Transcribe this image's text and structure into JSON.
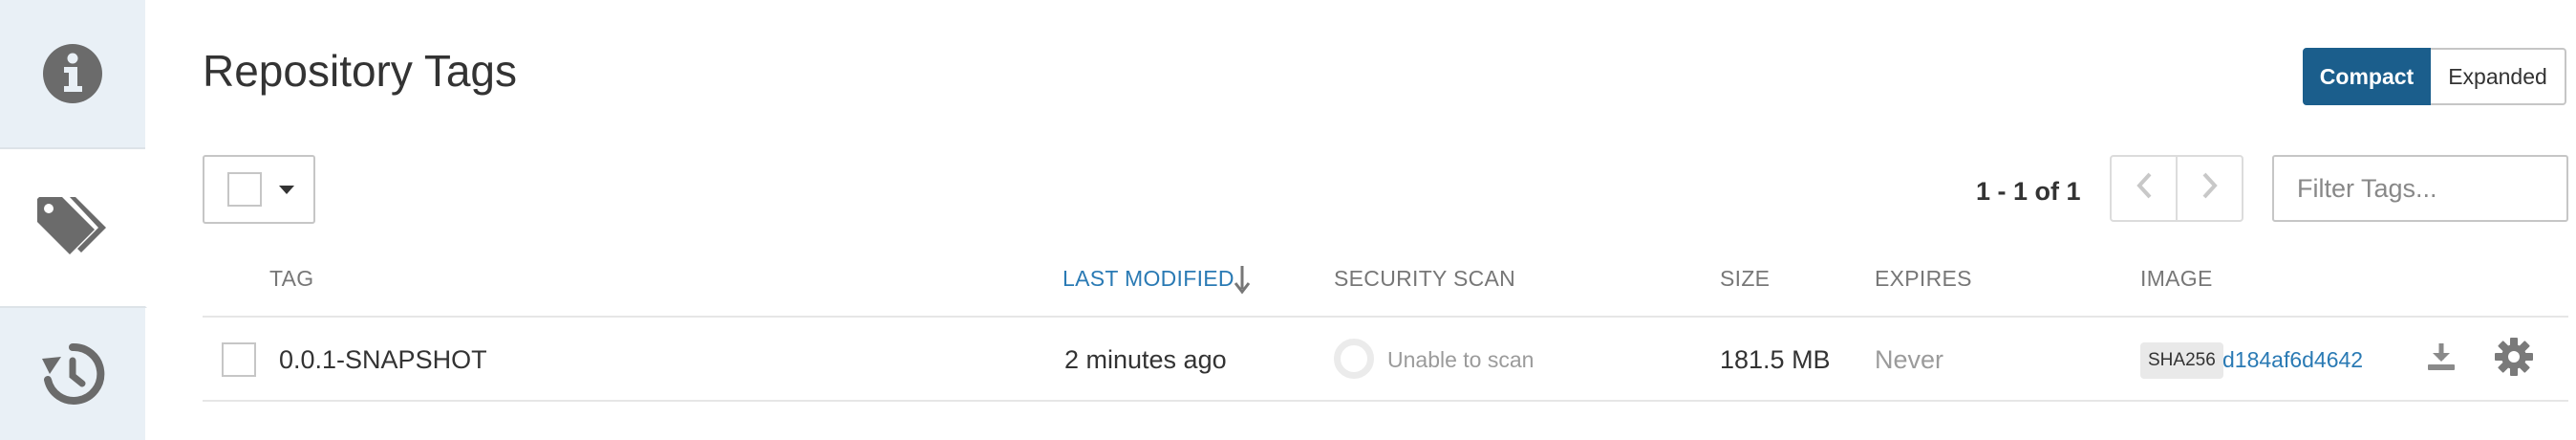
{
  "sidebar": {
    "tabs": [
      {
        "name": "info",
        "icon": "info-circle-icon"
      },
      {
        "name": "tags",
        "icon": "tags-icon"
      },
      {
        "name": "history",
        "icon": "history-icon"
      }
    ]
  },
  "header": {
    "title": "Repository Tags",
    "view_compact": "Compact",
    "view_expanded": "Expanded"
  },
  "toolbar": {
    "page_count": "1 - 1 of 1",
    "filter_placeholder": "Filter Tags..."
  },
  "table": {
    "columns": {
      "tag": "TAG",
      "last_modified": "LAST MODIFIED",
      "security_scan": "SECURITY SCAN",
      "size": "SIZE",
      "expires": "EXPIRES",
      "image": "IMAGE"
    },
    "rows": [
      {
        "tag": "0.0.1-SNAPSHOT",
        "last_modified": "2 minutes ago",
        "security_scan": "Unable to scan",
        "size": "181.5 MB",
        "expires": "Never",
        "digest_algo": "SHA256",
        "digest": "d184af6d4642"
      }
    ]
  },
  "colors": {
    "accent": "#1b5e8c",
    "link": "#2a7ab4",
    "sidebar_bg": "#e9f0f6",
    "icon": "#6b6b6b"
  }
}
